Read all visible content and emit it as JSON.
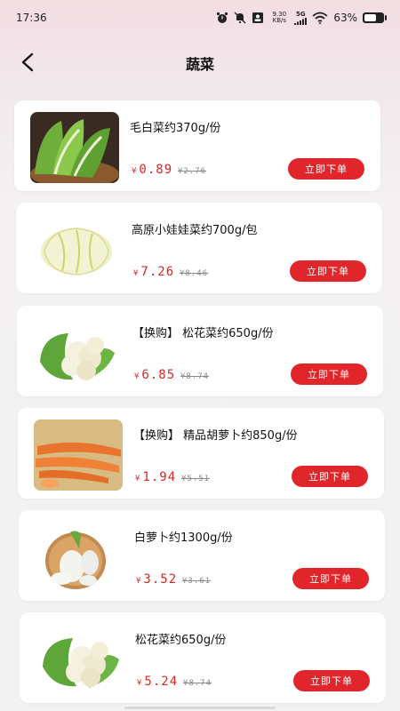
{
  "status_bar": {
    "time": "17:36",
    "net_speed_value": "9.30",
    "net_speed_unit": "KB/s",
    "network": "5G",
    "battery": "63%",
    "battery_level": 0.63
  },
  "header": {
    "title": "蔬菜"
  },
  "colors": {
    "accent": "#e0262b",
    "price": "#d62828"
  },
  "items": [
    {
      "name": "毛白菜约370g/份",
      "currency": "¥",
      "price": "0.89",
      "original_price": "¥2.76",
      "button": "立即下单",
      "image": "napa-cabbage-basket"
    },
    {
      "name": "高原小娃娃菜约700g/包",
      "currency": "¥",
      "price": "7.26",
      "original_price": "¥8.46",
      "button": "立即下单",
      "image": "baby-cabbage"
    },
    {
      "name": "【换购】 松花菜约650g/份",
      "currency": "¥",
      "price": "6.85",
      "original_price": "¥8.74",
      "button": "立即下单",
      "image": "cauliflower"
    },
    {
      "name": "【换购】 精品胡萝卜约850g/份",
      "currency": "¥",
      "price": "1.94",
      "original_price": "¥5.51",
      "button": "立即下单",
      "image": "carrots"
    },
    {
      "name": "白萝卜约1300g/份",
      "currency": "¥",
      "price": "3.52",
      "original_price": "¥3.61",
      "button": "立即下单",
      "image": "white-radish"
    },
    {
      "name": "松花菜约650g/份",
      "currency": "¥",
      "price": "5.24",
      "original_price": "¥8.74",
      "button": "立即下单",
      "image": "cauliflower"
    }
  ]
}
